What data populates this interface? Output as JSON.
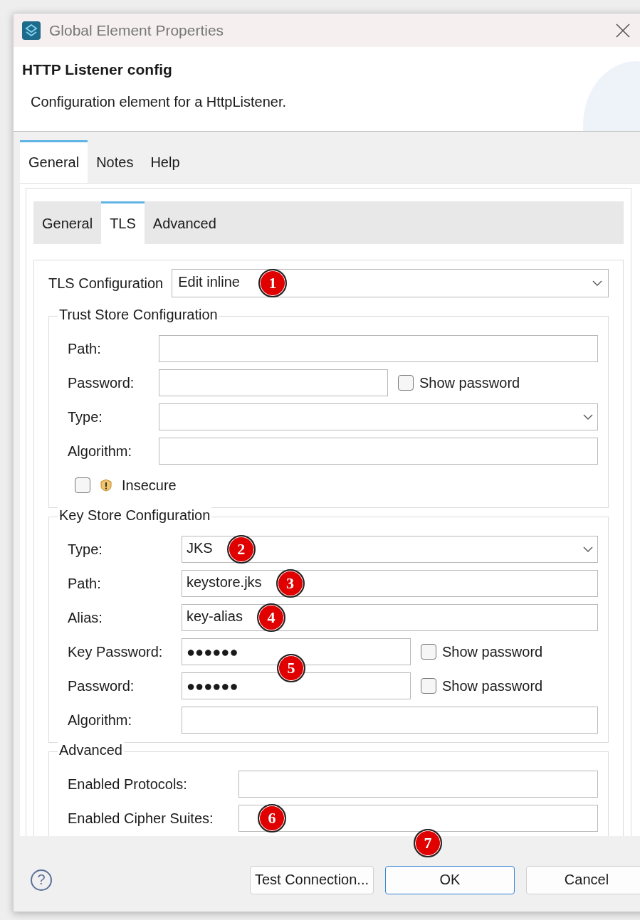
{
  "window": {
    "title": "Global Element Properties"
  },
  "header": {
    "title": "HTTP Listener config",
    "description": "Configuration element for a HttpListener."
  },
  "tabs": [
    {
      "label": "General",
      "selected": true
    },
    {
      "label": "Notes",
      "selected": false
    },
    {
      "label": "Help",
      "selected": false
    }
  ],
  "subtabs": [
    {
      "label": "General",
      "selected": false
    },
    {
      "label": "TLS",
      "selected": true
    },
    {
      "label": "Advanced",
      "selected": false
    }
  ],
  "tls_configuration": {
    "label": "TLS Configuration",
    "value": "Edit inline",
    "badge": "1"
  },
  "sections": [
    {
      "title": "Trust Store Configuration",
      "fields": [
        {
          "kind": "text",
          "label": "Path:"
        },
        {
          "kind": "password",
          "label": "Password:",
          "show_password": {
            "label": "Show password",
            "checked": false
          }
        },
        {
          "kind": "select",
          "label": "Type:"
        },
        {
          "kind": "text",
          "label": "Algorithm:"
        },
        {
          "kind": "checkbox",
          "label": "Insecure",
          "checked": false
        }
      ]
    },
    {
      "title": "Key Store Configuration",
      "fields": [
        {
          "kind": "select",
          "label": "Type:",
          "value": "JKS",
          "badge": "2"
        },
        {
          "kind": "text",
          "label": "Path:",
          "value": "keystore.jks",
          "badge": "3"
        },
        {
          "kind": "text",
          "label": "Alias:",
          "value": "key-alias",
          "badge": "4"
        },
        {
          "kind": "password",
          "label": "Key Password:",
          "value": "●●●●●●",
          "badge": "5",
          "show_password": {
            "label": "Show password",
            "checked": false
          }
        },
        {
          "kind": "password",
          "label": "Password:",
          "value": "●●●●●●",
          "show_password": {
            "label": "Show password",
            "checked": false
          }
        },
        {
          "kind": "text",
          "label": "Algorithm:"
        }
      ]
    },
    {
      "title": "Advanced",
      "fields": [
        {
          "kind": "text",
          "label": "Enabled Protocols:"
        },
        {
          "kind": "text",
          "label": "Enabled Cipher Suites:",
          "badge": "6"
        }
      ]
    }
  ],
  "help": {
    "icon": "?"
  },
  "buttons": [
    {
      "label": "Test Connection...",
      "default": false
    },
    {
      "label": "OK",
      "default": true,
      "badge": "7"
    },
    {
      "label": "Cancel",
      "default": false
    }
  ]
}
